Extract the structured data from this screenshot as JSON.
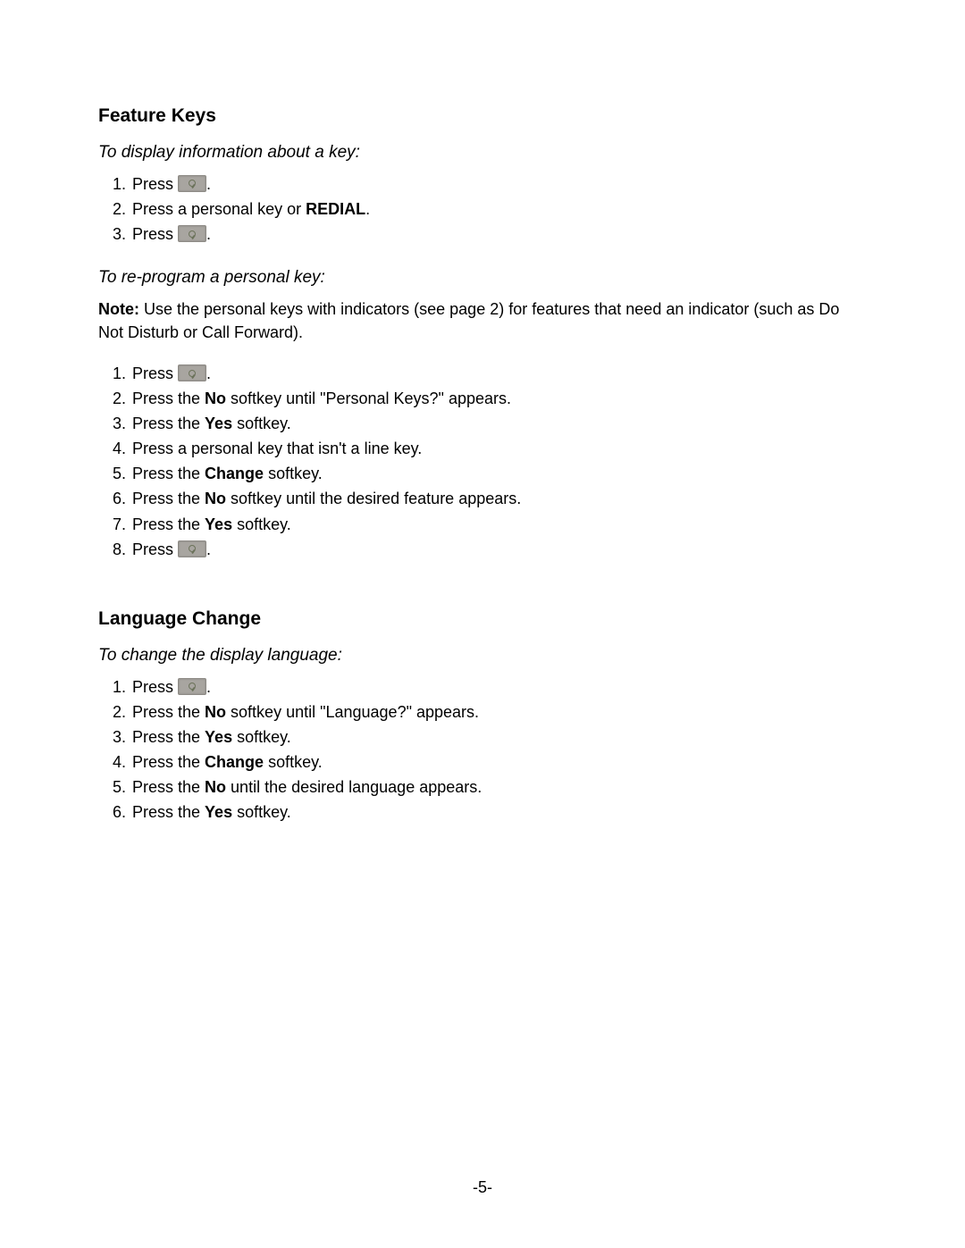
{
  "page_number": "-5-",
  "sections": {
    "feature_keys": {
      "heading": "Feature Keys",
      "display_intro": "To display information about a key:",
      "display_steps": {
        "s1_pre": "Press ",
        "s1_post": ".",
        "s2_pre": "Press a personal key or ",
        "s2_bold": "REDIAL",
        "s2_post": ".",
        "s3_pre": "Press ",
        "s3_post": "."
      },
      "reprogram_intro": "To re-program a personal key:",
      "note_label": "Note:",
      "note_text": " Use the personal keys with indicators (see page 2) for features that need an indicator (such as Do Not Disturb or Call Forward).",
      "reprogram_steps": {
        "s1_pre": "Press ",
        "s1_post": ".",
        "s2_a": "Press the ",
        "s2_bold": "No",
        "s2_b": " softkey until \"Personal Keys?\" appears.",
        "s3_a": "Press the ",
        "s3_bold": "Yes",
        "s3_b": " softkey.",
        "s4": "Press a personal key that isn't a line key.",
        "s5_a": "Press the ",
        "s5_bold": "Change",
        "s5_b": " softkey.",
        "s6_a": "Press the ",
        "s6_bold": "No",
        "s6_b": " softkey until the desired feature appears.",
        "s7_a": "Press the ",
        "s7_bold": "Yes",
        "s7_b": " softkey.",
        "s8_pre": "Press ",
        "s8_post": "."
      }
    },
    "language_change": {
      "heading": "Language Change",
      "intro": "To change the display language:",
      "steps": {
        "s1_pre": "Press ",
        "s1_post": ".",
        "s2_a": "Press the ",
        "s2_bold": "No",
        "s2_b": " softkey until \"Language?\" appears.",
        "s3_a": "Press the ",
        "s3_bold": "Yes",
        "s3_b": " softkey.",
        "s4_a": "Press the ",
        "s4_bold": "Change",
        "s4_b": " softkey.",
        "s5_a": "Press the ",
        "s5_bold": "No",
        "s5_b": " until the desired language appears.",
        "s6_a": "Press the ",
        "s6_bold": "Yes",
        "s6_b": " softkey."
      }
    }
  }
}
